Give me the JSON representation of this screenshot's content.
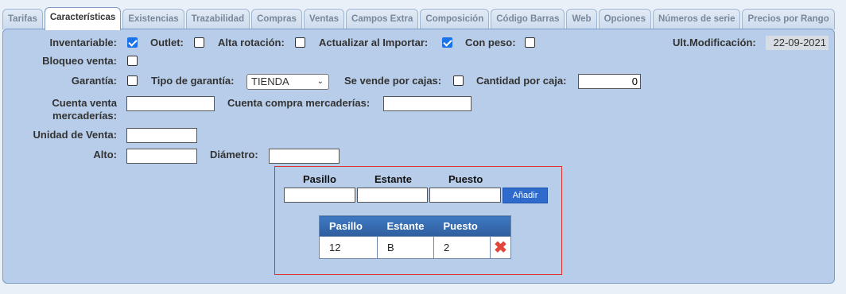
{
  "tabs": [
    "Tarifas",
    "Características",
    "Existencias",
    "Trazabilidad",
    "Compras",
    "Ventas",
    "Campos Extra",
    "Composición",
    "Código Barras",
    "Web",
    "Opciones",
    "Números de serie",
    "Precios por Rango"
  ],
  "active_tab": "Características",
  "fields": {
    "inventariable": {
      "label": "Inventariable:",
      "checked": true
    },
    "outlet": {
      "label": "Outlet:",
      "checked": false
    },
    "alta_rotacion": {
      "label": "Alta rotación:",
      "checked": false
    },
    "actualizar_importar": {
      "label": "Actualizar al Importar:",
      "checked": true
    },
    "con_peso": {
      "label": "Con peso:",
      "checked": false
    },
    "ult_modificacion": {
      "label": "Ult.Modificación:",
      "value": "22-09-2021"
    },
    "bloqueo_venta": {
      "label": "Bloqueo venta:",
      "checked": false
    },
    "garantia": {
      "label": "Garantía:",
      "checked": false
    },
    "tipo_garantia": {
      "label": "Tipo de garantía:",
      "value": "TIENDA"
    },
    "se_vende_por_cajas": {
      "label": "Se vende por cajas:",
      "checked": false
    },
    "cantidad_por_caja": {
      "label": "Cantidad por caja:",
      "value": "0"
    },
    "cuenta_venta_1": "Cuenta venta",
    "cuenta_venta_2": "mercaderías:",
    "cuenta_compra": {
      "label": "Cuenta compra mercaderías:",
      "value": ""
    },
    "unidad_venta": {
      "label": "Unidad de Venta:",
      "value": ""
    },
    "alto": {
      "label": "Alto:",
      "value": ""
    },
    "diametro": {
      "label": "Diámetro:",
      "value": ""
    }
  },
  "location": {
    "headers": [
      "Pasillo",
      "Estante",
      "Puesto"
    ],
    "add_button": "Añadir",
    "table_headers": [
      "Pasillo",
      "Estante",
      "Puesto"
    ],
    "rows": [
      {
        "pasillo": "12",
        "estante": "B",
        "puesto": "2"
      }
    ],
    "delete_icon": "close-x-icon",
    "delete_color": "#e0463c"
  },
  "colors": {
    "panel": "#b7cde9",
    "accent": "#2f6bcc",
    "border_red": "#d9342b"
  }
}
